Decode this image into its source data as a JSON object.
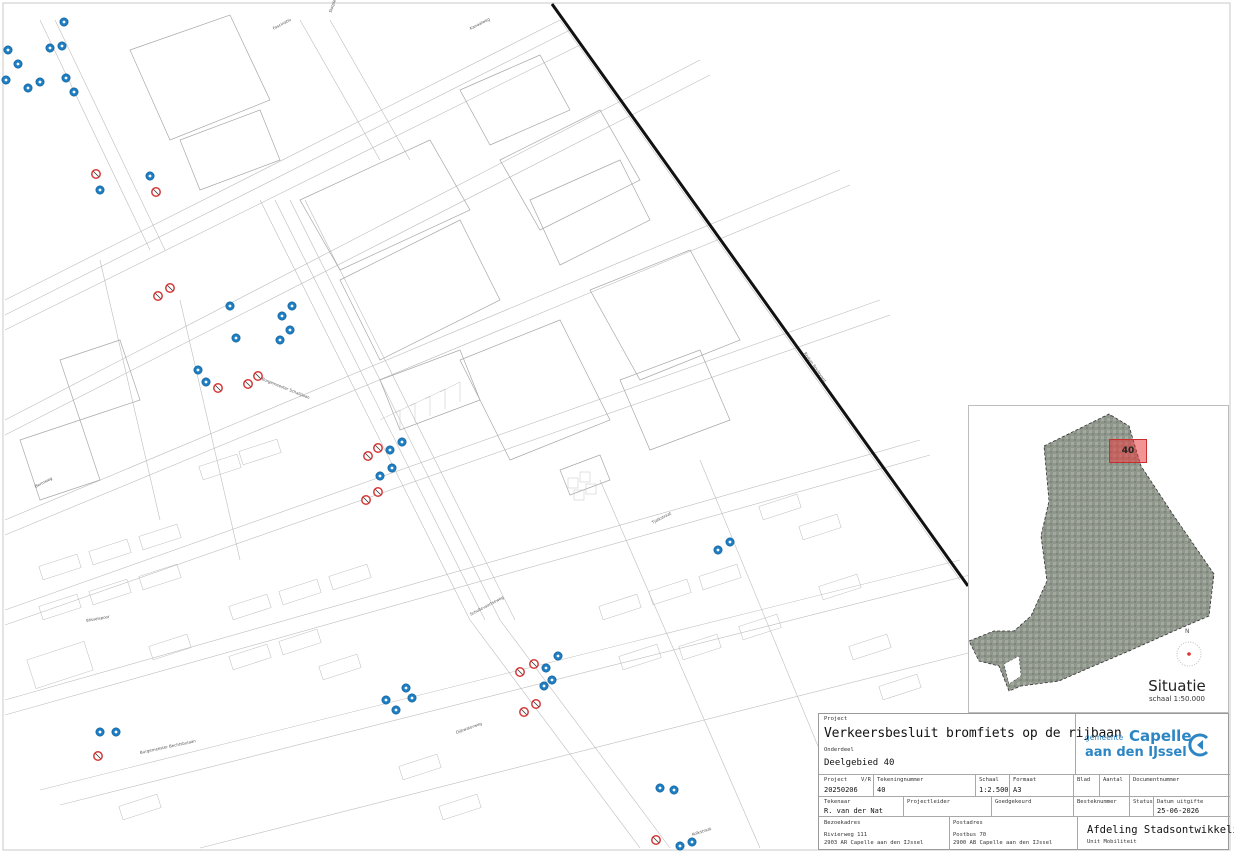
{
  "project": {
    "caption": "Project",
    "title": "Verkeersbesluit bromfiets op de rijbaan",
    "subtitle_caption": "Onderdeel",
    "subtitle": "Deelgebied 40"
  },
  "organisation": {
    "gemeente": "gemeente",
    "name_line1": "Capelle",
    "name_line2": "aan den IJssel",
    "department": "Afdeling Stadsontwikkeling",
    "unit": "Unit Mobiliteit"
  },
  "fields": {
    "project_no": {
      "label": "Project",
      "value": "20250206"
    },
    "vnr": {
      "label": "V/R",
      "value": ""
    },
    "drawing_no": {
      "label": "Tekeningnummer",
      "value": "40"
    },
    "scale": {
      "label": "Schaal",
      "value": "1:2.500"
    },
    "format": {
      "label": "Formaat",
      "value": "A3"
    },
    "sheet": {
      "label": "Blad",
      "value": ""
    },
    "count": {
      "label": "Aantal",
      "value": ""
    },
    "document_no": {
      "label": "Documentnummer",
      "value": ""
    },
    "drafter": {
      "label": "Tekenaar",
      "value": "R. van der Nat"
    },
    "project_lead": {
      "label": "Projectleider",
      "value": ""
    },
    "approved": {
      "label": "Goedgekeurd",
      "value": ""
    },
    "specification": {
      "label": "Besteknummer",
      "value": ""
    },
    "status": {
      "label": "Status",
      "value": ""
    },
    "issue_date": {
      "label": "Datum uitgifte",
      "value": "25-06-2026"
    }
  },
  "addresses": {
    "visit_label": "Bezoekadres",
    "visit_line1": "Rivierweg 111",
    "visit_line2": "2903 AR Capelle aan den IJssel",
    "postal_label": "Postadres",
    "postal_line1": "Postbus 70",
    "postal_line2": "2900 AB Capelle aan den IJssel"
  },
  "inset": {
    "title": "Situatie",
    "scale": "schaal 1:50.000",
    "area_number": "40",
    "north": "N"
  },
  "streets": [
    "Kanaalweg",
    "Rivium Boulevard",
    "Bermweg",
    "Fascinatio",
    "Slotplein",
    "Burgemeester Schalijlaan",
    "Tjalkstraat",
    "Wisselspoor",
    "Schollevaartseweg",
    "Burgemeester Bechtsbulaan",
    "Dijkwaterweg",
    "Kolkstraat"
  ],
  "signs": {
    "blue_color": "#1d7ec3",
    "red_color": "#d43a3a",
    "blue": [
      [
        64,
        22
      ],
      [
        50,
        48
      ],
      [
        62,
        46
      ],
      [
        8,
        50
      ],
      [
        18,
        64
      ],
      [
        28,
        88
      ],
      [
        40,
        82
      ],
      [
        66,
        78
      ],
      [
        74,
        92
      ],
      [
        6,
        80
      ],
      [
        150,
        176
      ],
      [
        100,
        190
      ],
      [
        230,
        306
      ],
      [
        236,
        338
      ],
      [
        282,
        316
      ],
      [
        292,
        306
      ],
      [
        290,
        330
      ],
      [
        280,
        340
      ],
      [
        198,
        370
      ],
      [
        206,
        382
      ],
      [
        402,
        442
      ],
      [
        390,
        450
      ],
      [
        380,
        476
      ],
      [
        392,
        468
      ],
      [
        718,
        550
      ],
      [
        730,
        542
      ],
      [
        546,
        668
      ],
      [
        558,
        656
      ],
      [
        544,
        686
      ],
      [
        552,
        680
      ],
      [
        406,
        688
      ],
      [
        396,
        710
      ],
      [
        386,
        700
      ],
      [
        412,
        698
      ],
      [
        100,
        732
      ],
      [
        116,
        732
      ],
      [
        660,
        788
      ],
      [
        674,
        790
      ],
      [
        692,
        842
      ],
      [
        680,
        846
      ]
    ],
    "red": [
      [
        158,
        296
      ],
      [
        170,
        288
      ],
      [
        218,
        388
      ],
      [
        248,
        384
      ],
      [
        258,
        376
      ],
      [
        368,
        456
      ],
      [
        378,
        448
      ],
      [
        366,
        500
      ],
      [
        378,
        492
      ],
      [
        520,
        672
      ],
      [
        534,
        664
      ],
      [
        524,
        712
      ],
      [
        536,
        704
      ],
      [
        98,
        756
      ],
      [
        656,
        840
      ],
      [
        96,
        174
      ],
      [
        156,
        192
      ]
    ]
  }
}
